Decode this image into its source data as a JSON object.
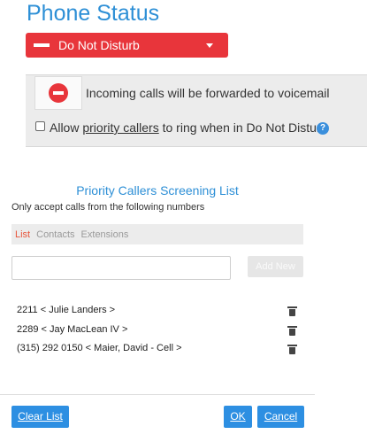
{
  "header": {
    "title": "Phone Status"
  },
  "status_select": {
    "value": "Do Not Disturb",
    "color": "#e8353b"
  },
  "dnd_panel": {
    "message": "Incoming calls will be forwarded to voicemail",
    "allow_prefix": "Allow ",
    "allow_link": "priority callers",
    "allow_suffix": " to ring when in Do Not Disturb",
    "help": "?",
    "priority_checked": false
  },
  "screening": {
    "title": "Priority Callers Screening List",
    "subtitle": "Only accept calls from the following numbers",
    "tabs": [
      {
        "label": "List",
        "active": true
      },
      {
        "label": "Contacts",
        "active": false
      },
      {
        "label": "Extensions",
        "active": false
      }
    ],
    "input_value": "",
    "add_label": "Add New",
    "callers": [
      {
        "text": "2211  < Julie Landers >"
      },
      {
        "text": "2289  < Jay MacLean IV >"
      },
      {
        "text": "(315) 292 0150  < Maier, David  -  Cell >"
      }
    ]
  },
  "footer": {
    "clear_label": "Clear List",
    "ok_label": "OK",
    "cancel_label": "Cancel"
  },
  "colors": {
    "accent": "#2d8fd6",
    "button": "#2d8fe2",
    "danger": "#e8353b"
  }
}
